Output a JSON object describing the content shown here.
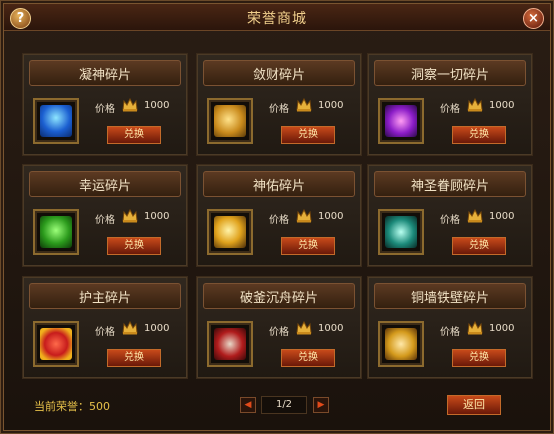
{
  "window": {
    "title": "荣誉商城"
  },
  "items": [
    {
      "name": "凝神碎片",
      "price_label": "价格",
      "price": "1000",
      "button": "兑换",
      "icon": "meditation-icon"
    },
    {
      "name": "敛财碎片",
      "price_label": "价格",
      "price": "1000",
      "button": "兑换",
      "icon": "coin-icon"
    },
    {
      "name": "洞察一切碎片",
      "price_label": "价格",
      "price": "1000",
      "button": "兑换",
      "icon": "eye-icon"
    },
    {
      "name": "幸运碎片",
      "price_label": "价格",
      "price": "1000",
      "button": "兑换",
      "icon": "clover-icon"
    },
    {
      "name": "神佑碎片",
      "price_label": "价格",
      "price": "1000",
      "button": "兑换",
      "icon": "blessing-hand-icon"
    },
    {
      "name": "神圣眷顾碎片",
      "price_label": "价格",
      "price": "1000",
      "button": "兑换",
      "icon": "holy-tree-icon"
    },
    {
      "name": "护主碎片",
      "price_label": "价格",
      "price": "1000",
      "button": "兑换",
      "icon": "heart-icon"
    },
    {
      "name": "破釜沉舟碎片",
      "price_label": "价格",
      "price": "1000",
      "button": "兑换",
      "icon": "broken-cauldron-icon"
    },
    {
      "name": "铜墙铁壁碎片",
      "price_label": "价格",
      "price": "1000",
      "button": "兑换",
      "icon": "shield-icon"
    }
  ],
  "footer": {
    "honor_label": "当前荣誉：",
    "honor_value": "500",
    "page": "1/2",
    "return_button": "返回"
  },
  "colors": {
    "title": "#f0cf8c",
    "accent_button": "#c84a1a",
    "honor_text": "#e6c04a"
  }
}
